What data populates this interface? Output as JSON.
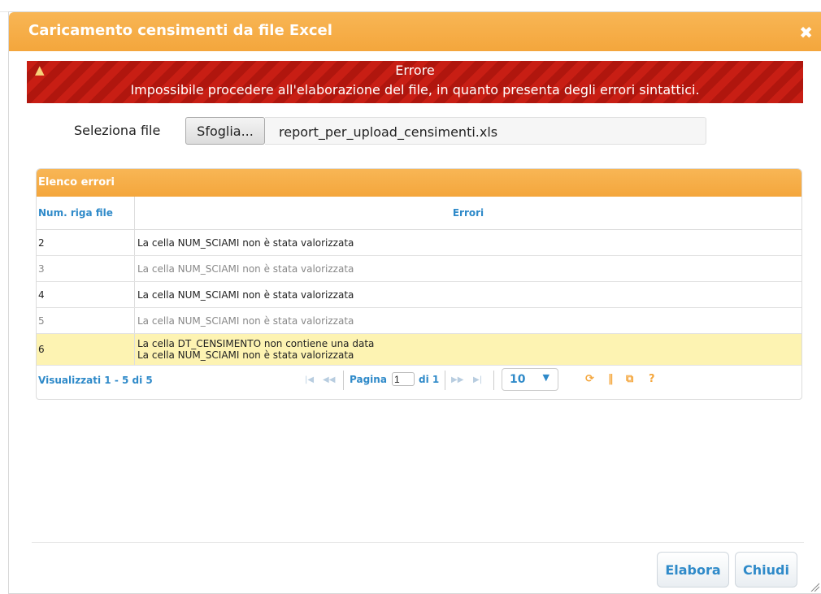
{
  "dialog": {
    "title": "Caricamento censimenti da file Excel",
    "close_glyph": "✖"
  },
  "error": {
    "icon": "warning-icon",
    "title": "Errore",
    "message": "Impossibile procedere all'elaborazione del file, in quanto presenta degli errori sintattici."
  },
  "file": {
    "label": "Seleziona file",
    "browse_label": "Sfoglia...",
    "filename": "report_per_upload_censimenti.xls"
  },
  "grid": {
    "caption": "Elenco errori",
    "columns": [
      "Num. riga file",
      "Errori"
    ],
    "rows": [
      {
        "num": "2",
        "errors": [
          "La cella NUM_SCIAMI non è stata valorizzata"
        ]
      },
      {
        "num": "3",
        "errors": [
          "La cella NUM_SCIAMI non è stata valorizzata"
        ]
      },
      {
        "num": "4",
        "errors": [
          "La cella NUM_SCIAMI non è stata valorizzata"
        ]
      },
      {
        "num": "5",
        "errors": [
          "La cella NUM_SCIAMI non è stata valorizzata"
        ]
      },
      {
        "num": "6",
        "errors": [
          "La cella DT_CENSIMENTO non contiene una data",
          "La cella NUM_SCIAMI non è stata valorizzata"
        ]
      }
    ]
  },
  "pager": {
    "count_text": "Visualizzati 1 - 5 di 5",
    "page_label": "Pagina",
    "page_value": "1",
    "of_label": "di 1",
    "rows_per_page": "10",
    "rows_arrow": "▼",
    "first_glyph": "|◀",
    "prev_glyph": "◀◀",
    "next_glyph": "▶▶",
    "last_glyph": "▶|",
    "refresh_glyph": "⟳",
    "columns_glyph": "‖",
    "export_glyph": "⧉",
    "help_glyph": "?"
  },
  "buttons": {
    "elabora": "Elabora",
    "chiudi": "Chiudi"
  },
  "colors": {
    "accent_orange": "#f4a63c",
    "error_red": "#c81e14",
    "link_blue": "#2f8ac9",
    "highlight_row": "#fdf3b2"
  }
}
